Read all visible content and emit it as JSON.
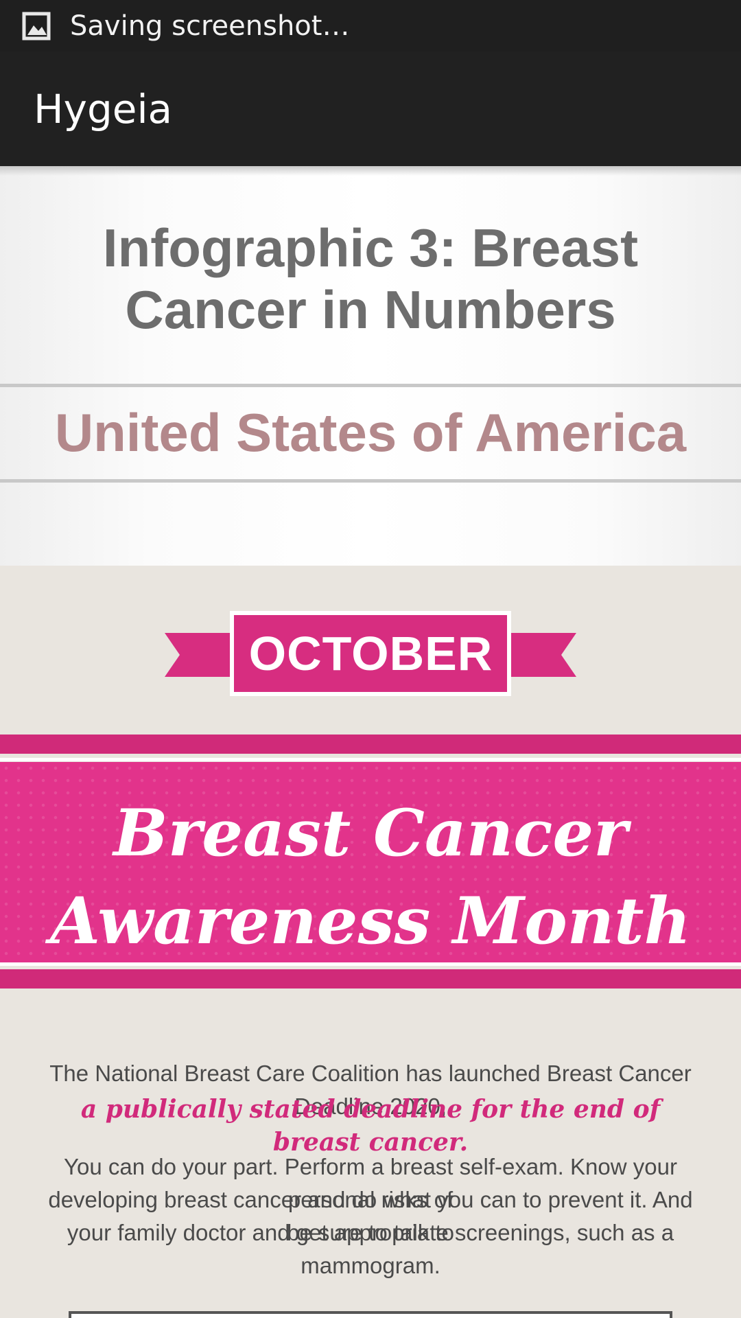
{
  "status_bar": {
    "icon": "image-icon",
    "text": "Saving screenshot…"
  },
  "action_bar": {
    "title": "Hygeia"
  },
  "content": {
    "title": "Infographic 3: Breast Cancer in Numbers",
    "country": "United States of America"
  },
  "infographic": {
    "month": "OCTOBER",
    "headline_line1": "Breast Cancer",
    "headline_line2": "Awareness Month",
    "intro": "The National Breast Care Coalition has launched Breast Cancer Deadline 2020,",
    "intro_accent": "a publically stated deadline for the end of breast cancer.",
    "body_line1": "You can do your part. Perform a breast self-exam. Know your personal risks of",
    "body_line2": "developing breast cancer and do what you can to prevent it. And be sure to talk to",
    "body_line3": "your family doctor and get appropriate screenings, such as a mammogram.",
    "colors": {
      "pink": "#e2338b",
      "dark_pink": "#d02a79",
      "background": "#e9e5df"
    }
  }
}
